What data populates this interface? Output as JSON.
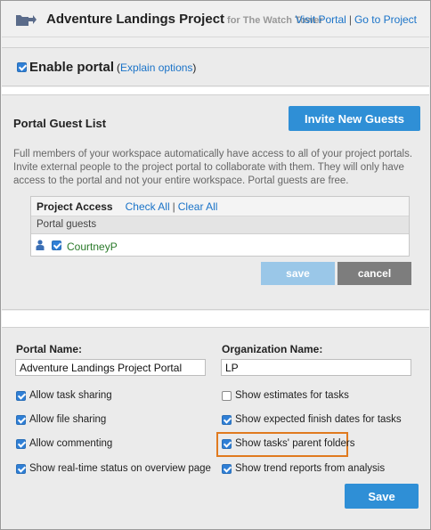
{
  "header": {
    "title": "Adventure Landings Project",
    "subtitle": "for The Watch Tower",
    "visit_portal": "Visit Portal",
    "separator": "|",
    "go_to_project": "Go to Project"
  },
  "enable_portal": {
    "checked": true,
    "label": "Enable portal",
    "paren_open": "(",
    "explain_link": "Explain options",
    "paren_close": ")"
  },
  "guest_list": {
    "title": "Portal Guest List",
    "invite_button": "Invite New Guests",
    "description": "Full members of your workspace automatically have access to all of your project portals. Invite external people to the project portal to collaborate with them. They will only have access to the portal and not your entire workspace. Portal guests are free.",
    "table": {
      "title": "Project Access",
      "check_all": "Check All",
      "separator": "|",
      "clear_all": "Clear All",
      "group_label": "Portal guests",
      "guests": [
        {
          "name": "CourtneyP",
          "checked": true
        }
      ]
    },
    "save_button": "save",
    "cancel_button": "cancel"
  },
  "settings": {
    "portal_name_label": "Portal Name:",
    "portal_name_value": "Adventure Landings Project Portal",
    "org_name_label": "Organization Name:",
    "org_name_value": "LP",
    "options_left": [
      {
        "label": "Allow task sharing",
        "checked": true
      },
      {
        "label": "Allow file sharing",
        "checked": true
      },
      {
        "label": "Allow commenting",
        "checked": true
      },
      {
        "label": "Show real-time status on overview page",
        "checked": true
      }
    ],
    "options_right": [
      {
        "label": "Show estimates for tasks",
        "checked": false
      },
      {
        "label": "Show expected finish dates for tasks",
        "checked": true
      },
      {
        "label": "Show tasks' parent folders",
        "checked": true
      },
      {
        "label": "Show trend reports from analysis",
        "checked": true
      }
    ],
    "save_button": "Save"
  },
  "colors": {
    "accent": "#2f8fd6",
    "highlight": "#e07a1f",
    "guest_name": "#2a7a2a"
  }
}
